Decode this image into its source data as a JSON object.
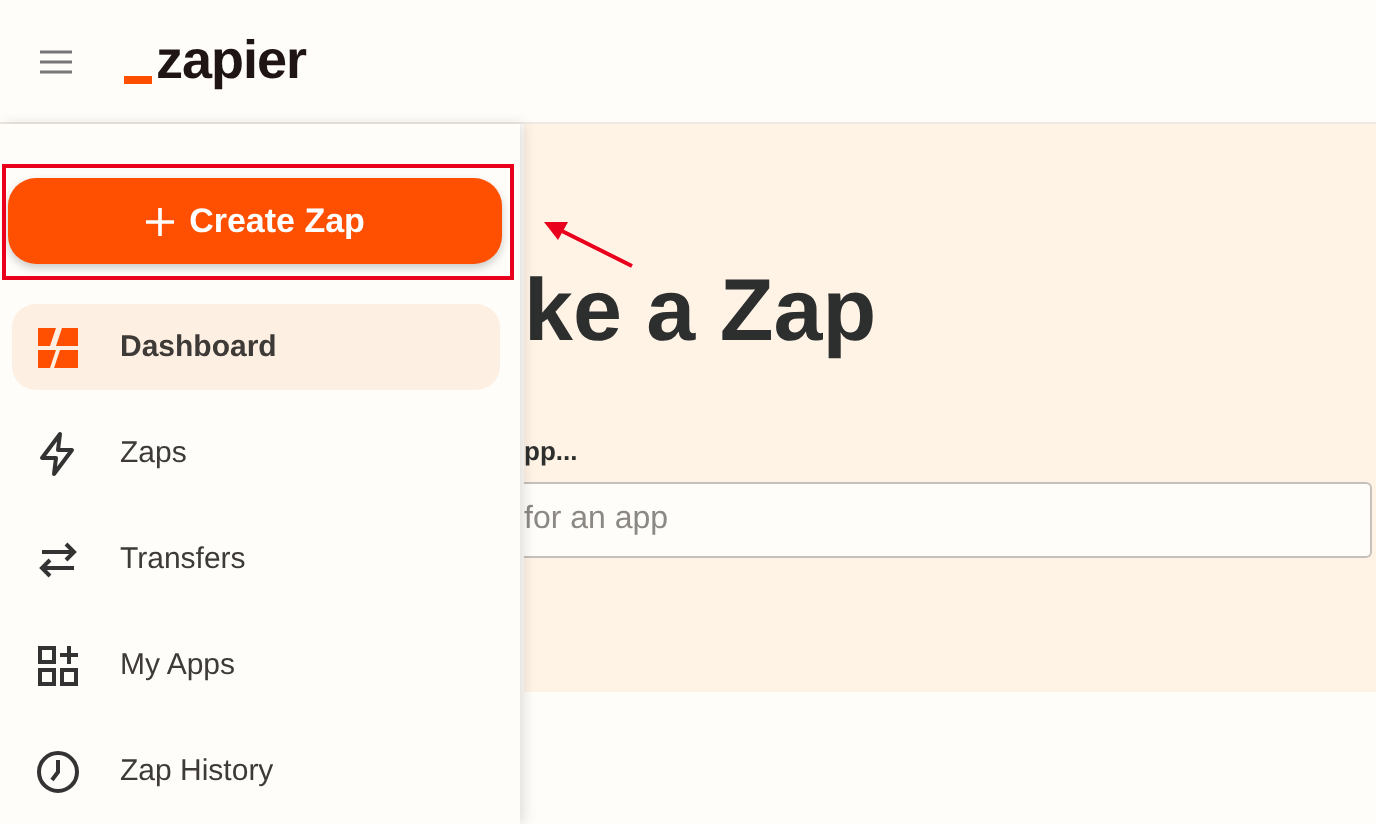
{
  "header": {
    "logo": "zapier"
  },
  "sidebar": {
    "create_button": "Create Zap",
    "items": [
      {
        "label": "Dashboard",
        "kind": "dashboard",
        "selected": true
      },
      {
        "label": "Zaps",
        "kind": "zaps",
        "selected": false
      },
      {
        "label": "Transfers",
        "kind": "transfers",
        "selected": false
      },
      {
        "label": "My Apps",
        "kind": "apps",
        "selected": false
      },
      {
        "label": "Zap History",
        "kind": "history",
        "selected": false
      }
    ]
  },
  "hero": {
    "heading": "ke a Zap",
    "label": "pp...",
    "search": {
      "placeholder": "for an app"
    }
  }
}
